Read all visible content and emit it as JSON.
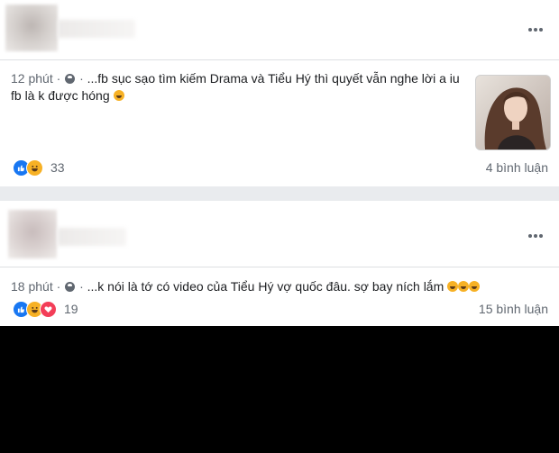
{
  "posts": [
    {
      "time": "12 phút",
      "dot": "·",
      "text": "...fb sục sạo tìm kiếm Drama và Tiểu Hý thì quyết vẫn nghe lời a iu fb là k được hóng",
      "reaction_count": "33",
      "comments": "4 bình luận",
      "reactions": [
        "like-icon",
        "haha-icon"
      ]
    },
    {
      "time": "18 phút",
      "dot": "·",
      "text": "...k nói là tớ có video của Tiểu Hý vợ quốc đâu. sợ bay ních lắm",
      "reaction_count": "19",
      "comments": "15 bình luận",
      "reactions": [
        "like-icon",
        "haha-icon",
        "love-icon"
      ]
    }
  ],
  "colors": {
    "page_bg": "#e9ebee",
    "card_bg": "#ffffff",
    "meta_text": "#606770",
    "body_text": "#1c1e21",
    "like": "#1877f2",
    "haha": "#f7b125",
    "love": "#f33e58",
    "overlay": "#000000"
  }
}
